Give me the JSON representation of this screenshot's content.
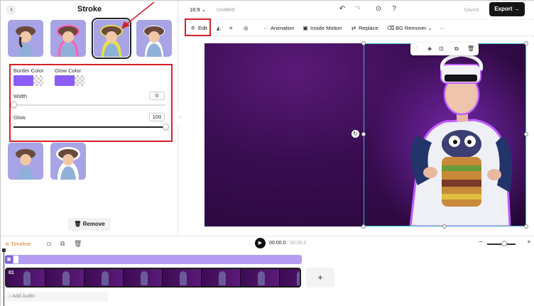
{
  "left_panel": {
    "title": "Stroke",
    "back_icon": "chevron-left-icon",
    "border_color_label": "Border Color",
    "glow_color_label": "Glow Color",
    "border_color": "#8b5cf6",
    "glow_color": "#8b5cf6",
    "width_label": "Width",
    "width_value": "0",
    "glow_label": "Glow",
    "glow_value": "100",
    "remove_label": "Remove",
    "remove_icon": "trash-icon"
  },
  "topbar": {
    "ratio": "16:9",
    "title": "Untitled",
    "saved": "Saved",
    "export_label": "Export"
  },
  "toolbar": {
    "edit": "Edit",
    "animation": "Animation",
    "inside_motion": "Inside Motion",
    "replace": "Replace",
    "bg_remover": "BG Remover",
    "more": "···"
  },
  "timeline": {
    "label": "Timeline",
    "time_current": "00:00.0",
    "time_total": "/ 00:06.0",
    "track_no": "01",
    "add_audio": "Add Audio",
    "add_clip": "+"
  },
  "colors": {
    "accent_red": "#d6202a",
    "export_bg": "#151515",
    "thumb_bg": "#a8a4e6",
    "selection": "#39b8d0"
  }
}
